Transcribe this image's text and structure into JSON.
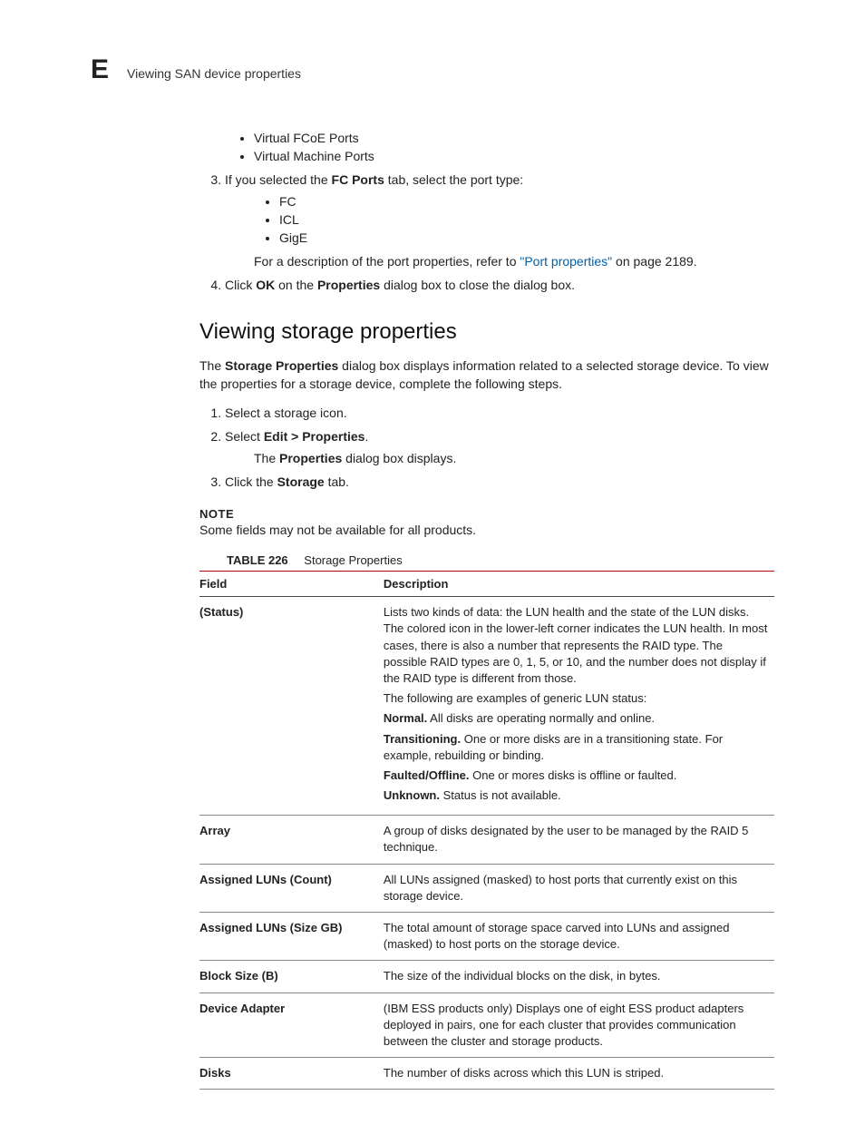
{
  "header": {
    "appendix_letter": "E",
    "running_title": "Viewing SAN device properties"
  },
  "continued": {
    "bullets_a": [
      "Virtual FCoE Ports",
      "Virtual Machine Ports"
    ],
    "step3_pre": "If you selected the ",
    "step3_bold": "FC Ports",
    "step3_post": " tab, select the port type:",
    "bullets_b": [
      "FC",
      "ICL",
      "GigE"
    ],
    "step3_tail_pre": "For a description of the port properties, refer to ",
    "step3_link": "\"Port properties\"",
    "step3_tail_post": " on page 2189.",
    "step4_pre": "Click ",
    "step4_b1": "OK",
    "step4_mid": " on the ",
    "step4_b2": "Properties",
    "step4_post": " dialog box to close the dialog box."
  },
  "section": {
    "heading": "Viewing storage properties",
    "intro_pre": "The ",
    "intro_bold": "Storage Properties",
    "intro_post": " dialog box displays information related to a selected storage device. To view the properties for a storage device, complete the following steps.",
    "steps": {
      "s1": "Select a storage icon.",
      "s2_pre": "Select ",
      "s2_bold": "Edit > Properties",
      "s2_post": ".",
      "s2_result_pre": "The ",
      "s2_result_bold": "Properties",
      "s2_result_post": " dialog box displays.",
      "s3_pre": "Click the ",
      "s3_bold": "Storage",
      "s3_post": " tab."
    },
    "note": {
      "label": "NOTE",
      "text": "Some fields may not be available for all products."
    }
  },
  "table": {
    "number": "TABLE 226",
    "title": "Storage Properties",
    "head_field": "Field",
    "head_desc": "Description",
    "rows": [
      {
        "field": "(Status)",
        "desc": {
          "p1": "Lists two kinds of data: the LUN health and the state of the LUN disks. The colored icon in the lower-left corner indicates the LUN health. In most cases, there is also a number that represents the RAID type. The possible RAID types are 0, 1, 5, or 10, and the number does not display if the RAID type is different from those.",
          "p2": "The following are examples of generic LUN status:",
          "ex1_b": "Normal.",
          "ex1_t": " All disks are operating normally and online.",
          "ex2_b": "Transitioning.",
          "ex2_t": " One or more disks are in a transitioning state. For example, rebuilding or binding.",
          "ex3_b": "Faulted/Offline.",
          "ex3_t": " One or mores disks is offline or faulted.",
          "ex4_b": "Unknown.",
          "ex4_t": " Status is not available."
        }
      },
      {
        "field": "Array",
        "desc_plain": "A group of disks designated by the user to be managed by the RAID 5 technique."
      },
      {
        "field": "Assigned LUNs (Count)",
        "desc_plain": "All LUNs assigned (masked) to host ports that currently exist on this storage device."
      },
      {
        "field": "Assigned LUNs (Size GB)",
        "desc_plain": "The total amount of storage space carved into LUNs and assigned (masked) to host ports on the storage device."
      },
      {
        "field": "Block Size (B)",
        "desc_plain": "The size of the individual blocks on the disk, in bytes."
      },
      {
        "field": "Device Adapter",
        "desc_plain": "(IBM ESS products only) Displays one of eight ESS product adapters deployed in pairs, one for each cluster that provides communication between the cluster and storage products."
      },
      {
        "field": "Disks",
        "desc_plain": "The number of disks across which this LUN is striped."
      }
    ]
  }
}
